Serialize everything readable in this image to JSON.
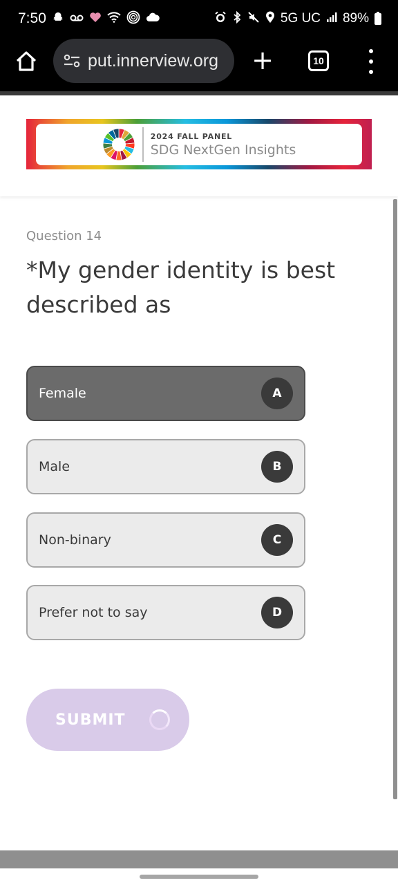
{
  "status_bar": {
    "time": "7:50",
    "network": "5G UC",
    "battery": "89%",
    "left_icons": [
      "snapchat-icon",
      "voicemail-icon",
      "heart-icon",
      "wifi-icon",
      "fingerprint-icon",
      "cloud-icon"
    ],
    "right_icons": [
      "alarm-icon",
      "bluetooth-icon",
      "mute-icon",
      "location-icon",
      "signal-icon",
      "battery-icon"
    ]
  },
  "browser": {
    "url": "put.innerview.org",
    "tab_count": "10",
    "new_tab_symbol": "+"
  },
  "banner": {
    "kicker": "2024 FALL PANEL",
    "title": "SDG NextGen Insights"
  },
  "question": {
    "number_label": "Question 14",
    "text": "*My gender identity is best described as"
  },
  "options": [
    {
      "label": "Female",
      "key": "A",
      "selected": true
    },
    {
      "label": "Male",
      "key": "B",
      "selected": false
    },
    {
      "label": "Non-binary",
      "key": "C",
      "selected": false
    },
    {
      "label": "Prefer not to say",
      "key": "D",
      "selected": false
    }
  ],
  "submit": {
    "label": "SUBMIT"
  },
  "colors": {
    "selected_option": "#6b6b6b",
    "option_bg": "#ebebeb",
    "key_badge": "#3a3a3a",
    "submit_bg": "#d9cbe9"
  }
}
